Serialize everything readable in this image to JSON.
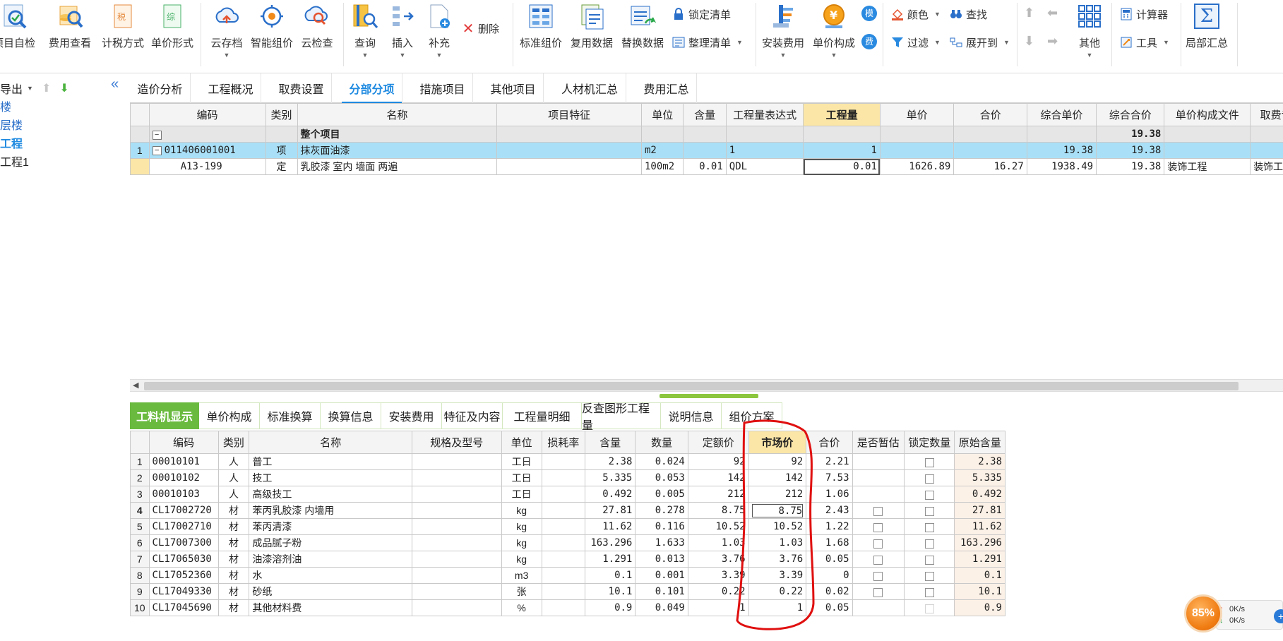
{
  "ribbon": {
    "group1": [
      {
        "label": "项目自检",
        "icon": "check-magnifier-icon"
      },
      {
        "label": "费用查看",
        "icon": "coins-magnifier-icon"
      },
      {
        "label": "计税方式",
        "icon": "tax-doc-icon"
      },
      {
        "label": "单价形式",
        "icon": "price-doc-icon"
      }
    ],
    "group2": [
      {
        "label": "云存档",
        "icon": "cloud-upload-icon"
      },
      {
        "label": "智能组价",
        "icon": "smart-price-icon"
      },
      {
        "label": "云检查",
        "icon": "cloud-check-icon"
      }
    ],
    "group3": [
      {
        "label": "查询",
        "icon": "book-search-icon"
      },
      {
        "label": "插入",
        "icon": "insert-rows-icon"
      },
      {
        "label": "补充",
        "icon": "add-doc-icon"
      }
    ],
    "delete_label": "删除",
    "group4": [
      {
        "label": "标准组价",
        "icon": "standard-price-icon"
      },
      {
        "label": "复用数据",
        "icon": "reuse-data-icon"
      },
      {
        "label": "替换数据",
        "icon": "replace-data-icon"
      }
    ],
    "lock_list_label": "锁定清单",
    "organize_list_label": "整理清单",
    "group5": [
      {
        "label": "安装费用",
        "icon": "install-fee-icon"
      },
      {
        "label": "单价构成",
        "icon": "yuan-coin-icon"
      }
    ],
    "mo_badge": "模",
    "fee_badge": "费",
    "color_label": "颜色",
    "find_label": "查找",
    "filter_label": "过滤",
    "expand_label": "展开到",
    "other_label": "其他",
    "calculator_label": "计算器",
    "tools_label": "工具",
    "partial_sum_label": "局部汇总",
    "partial_sum_symbol": "Σ"
  },
  "leftpanel": {
    "export_label": "导出",
    "collapse_symbol": "«",
    "tree": [
      {
        "label": "楼",
        "color": "#2a6fc9",
        "bold": false
      },
      {
        "label": "层楼",
        "color": "#2a6fc9",
        "bold": false
      },
      {
        "label": "工程",
        "color": "#1f8ae0",
        "bold": true
      },
      {
        "label": "工程1",
        "color": "#222222",
        "bold": false
      }
    ]
  },
  "maintabs": [
    "造价分析",
    "工程概况",
    "取费设置",
    "分部分项",
    "措施项目",
    "其他项目",
    "人材机汇总",
    "费用汇总"
  ],
  "maintab_active": "分部分项",
  "upper": {
    "headers": [
      "编码",
      "类别",
      "名称",
      "项目特征",
      "单位",
      "含量",
      "工程量表达式",
      "工程量",
      "单价",
      "合价",
      "综合单价",
      "综合合价",
      "单价构成文件",
      "取费专"
    ],
    "group_row": {
      "name": "整个项目",
      "total": "19.38"
    },
    "rows": [
      {
        "no": "1",
        "code": "011406001001",
        "type": "项",
        "name": "抹灰面油漆",
        "feature": "",
        "unit": "m2",
        "content": "",
        "expr": "1",
        "qty": "1",
        "price": "",
        "amount": "",
        "unit_total": "19.38",
        "total": "19.38",
        "file": "",
        "fee": ""
      },
      {
        "no": "",
        "code": "A13-199",
        "type": "定",
        "name": "乳胶漆 室内 墙面 两遍",
        "feature": "",
        "unit": "100m2",
        "content": "0.01",
        "expr": "QDL",
        "qty": "0.01",
        "price": "1626.89",
        "amount": "16.27",
        "unit_total": "1938.49",
        "total": "19.38",
        "file": "装饰工程",
        "fee": "装饰工程"
      }
    ]
  },
  "lowertabs": [
    "工料机显示",
    "单价构成",
    "标准换算",
    "换算信息",
    "安装费用",
    "特征及内容",
    "工程量明细",
    "反查图形工程量",
    "说明信息",
    "组价方案"
  ],
  "lowertab_active": "工料机显示",
  "lower": {
    "headers": [
      "编码",
      "类别",
      "名称",
      "规格及型号",
      "单位",
      "损耗率",
      "含量",
      "数量",
      "定额价",
      "市场价",
      "合价",
      "是否暂估",
      "锁定数量",
      "原始含量"
    ],
    "rows": [
      {
        "no": "1",
        "code": "00010101",
        "type": "人",
        "name": "普工",
        "spec": "",
        "unit": "工日",
        "loss": "",
        "content": "2.38",
        "qty": "0.024",
        "quota": "92",
        "market": "92",
        "amount": "2.21",
        "est": false,
        "lock": true,
        "orig": "2.38"
      },
      {
        "no": "2",
        "code": "00010102",
        "type": "人",
        "name": "技工",
        "spec": "",
        "unit": "工日",
        "loss": "",
        "content": "5.335",
        "qty": "0.053",
        "quota": "142",
        "market": "142",
        "amount": "7.53",
        "est": false,
        "lock": true,
        "orig": "5.335"
      },
      {
        "no": "3",
        "code": "00010103",
        "type": "人",
        "name": "高级技工",
        "spec": "",
        "unit": "工日",
        "loss": "",
        "content": "0.492",
        "qty": "0.005",
        "quota": "212",
        "market": "212",
        "amount": "1.06",
        "est": false,
        "lock": true,
        "orig": "0.492"
      },
      {
        "no": "4",
        "code": "CL17002720",
        "type": "材",
        "name": "苯丙乳胶漆 内墙用",
        "spec": "",
        "unit": "kg",
        "loss": "",
        "content": "27.81",
        "qty": "0.278",
        "quota": "8.75",
        "market": "8.75",
        "amount": "2.43",
        "est": true,
        "lock": true,
        "orig": "27.81"
      },
      {
        "no": "5",
        "code": "CL17002710",
        "type": "材",
        "name": "苯丙清漆",
        "spec": "",
        "unit": "kg",
        "loss": "",
        "content": "11.62",
        "qty": "0.116",
        "quota": "10.52",
        "market": "10.52",
        "amount": "1.22",
        "est": true,
        "lock": true,
        "orig": "11.62"
      },
      {
        "no": "6",
        "code": "CL17007300",
        "type": "材",
        "name": "成品腻子粉",
        "spec": "",
        "unit": "kg",
        "loss": "",
        "content": "163.296",
        "qty": "1.633",
        "quota": "1.03",
        "market": "1.03",
        "amount": "1.68",
        "est": true,
        "lock": true,
        "orig": "163.296"
      },
      {
        "no": "7",
        "code": "CL17065030",
        "type": "材",
        "name": "油漆溶剂油",
        "spec": "",
        "unit": "kg",
        "loss": "",
        "content": "1.291",
        "qty": "0.013",
        "quota": "3.76",
        "market": "3.76",
        "amount": "0.05",
        "est": true,
        "lock": true,
        "orig": "1.291"
      },
      {
        "no": "8",
        "code": "CL17052360",
        "type": "材",
        "name": "水",
        "spec": "",
        "unit": "m3",
        "loss": "",
        "content": "0.1",
        "qty": "0.001",
        "quota": "3.39",
        "market": "3.39",
        "amount": "0",
        "est": true,
        "lock": true,
        "orig": "0.1"
      },
      {
        "no": "9",
        "code": "CL17049330",
        "type": "材",
        "name": "砂纸",
        "spec": "",
        "unit": "张",
        "loss": "",
        "content": "10.1",
        "qty": "0.101",
        "quota": "0.22",
        "market": "0.22",
        "amount": "0.02",
        "est": true,
        "lock": true,
        "orig": "10.1"
      },
      {
        "no": "10",
        "code": "CL17045690",
        "type": "材",
        "name": "其他材料费",
        "spec": "",
        "unit": "%",
        "loss": "",
        "content": "0.9",
        "qty": "0.049",
        "quota": "1",
        "market": "1",
        "amount": "0.05",
        "est": false,
        "lock": false,
        "orig": "0.9"
      }
    ]
  },
  "speed": {
    "percent": "85%",
    "up": "0K/s",
    "down": "0K/s"
  },
  "colors": {
    "accent": "#1f8ae0",
    "green": "#6aba3f",
    "annotation": "#e01010",
    "selected_row": "#a9e0f7",
    "highlight_header": "#fbe6a8"
  }
}
